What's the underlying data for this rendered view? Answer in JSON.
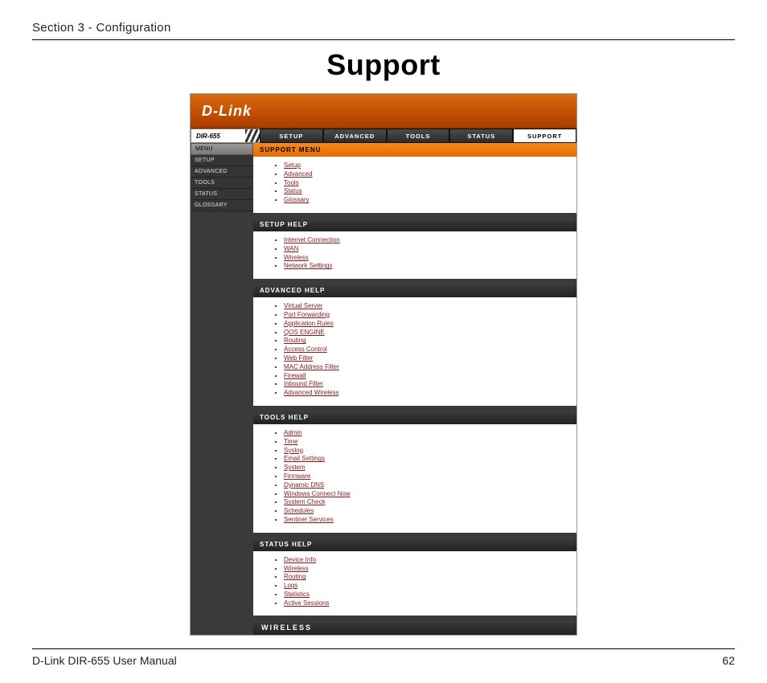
{
  "doc": {
    "section_header": "Section 3 - Configuration",
    "title": "Support",
    "footer_left": "D-Link DIR-655 User Manual",
    "page_number": "62"
  },
  "router": {
    "brand": "D-Link",
    "model": "DIR-655",
    "tabs": [
      "SETUP",
      "ADVANCED",
      "TOOLS",
      "STATUS",
      "SUPPORT"
    ],
    "active_tab": "SUPPORT",
    "sidebar_header": "MENU",
    "sidebar": [
      "SETUP",
      "ADVANCED",
      "TOOLS",
      "STATUS",
      "GLOSSARY"
    ],
    "panels": [
      {
        "title": "SUPPORT MENU",
        "style": "orange",
        "links": [
          "Setup",
          "Advanced",
          "Tools",
          "Status",
          "Glossary"
        ]
      },
      {
        "title": "SETUP HELP",
        "style": "dark",
        "links": [
          "Internet Connection",
          "WAN",
          "Wireless",
          "Network Settings"
        ]
      },
      {
        "title": "ADVANCED HELP",
        "style": "dark",
        "links": [
          "Virtual Server",
          "Port Forwarding",
          "Application Rules",
          "QOS ENGINE",
          "Routing",
          "Access Control",
          "Web Filter",
          "MAC Address Filter",
          "Firewall",
          "Inbound Filter",
          "Advanced Wireless"
        ]
      },
      {
        "title": "TOOLS HELP",
        "style": "dark",
        "links": [
          "Admin",
          "Time",
          "Syslog",
          "Email Settings",
          "System",
          "Firmware",
          "Dynamic DNS",
          "Windows Connect Now",
          "System Check",
          "Schedules",
          "Sentinel Services"
        ]
      },
      {
        "title": "STATUS HELP",
        "style": "dark",
        "links": [
          "Device Info",
          "Wireless",
          "Routing",
          "Logs",
          "Statistics",
          "Active Sessions"
        ]
      }
    ],
    "footer_strip": "WIRELESS"
  }
}
